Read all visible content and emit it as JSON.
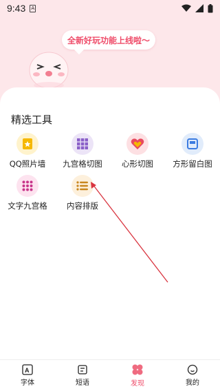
{
  "status": {
    "time": "9:43",
    "notif": "A"
  },
  "hero": {
    "bubble_text": "全新好玩功能上线啦～"
  },
  "section": {
    "title": "精选工具"
  },
  "tools": [
    {
      "label": "QQ照片墙"
    },
    {
      "label": "九宫格切图"
    },
    {
      "label": "心形切图"
    },
    {
      "label": "方形留白图"
    },
    {
      "label": "文字九宫格"
    },
    {
      "label": "内容排版"
    }
  ],
  "tabs": [
    {
      "label": "字体"
    },
    {
      "label": "短语"
    },
    {
      "label": "发现"
    },
    {
      "label": "我的"
    }
  ],
  "colors": {
    "accent": "#ef4d6a",
    "hero_bg": "#fde7ea"
  }
}
